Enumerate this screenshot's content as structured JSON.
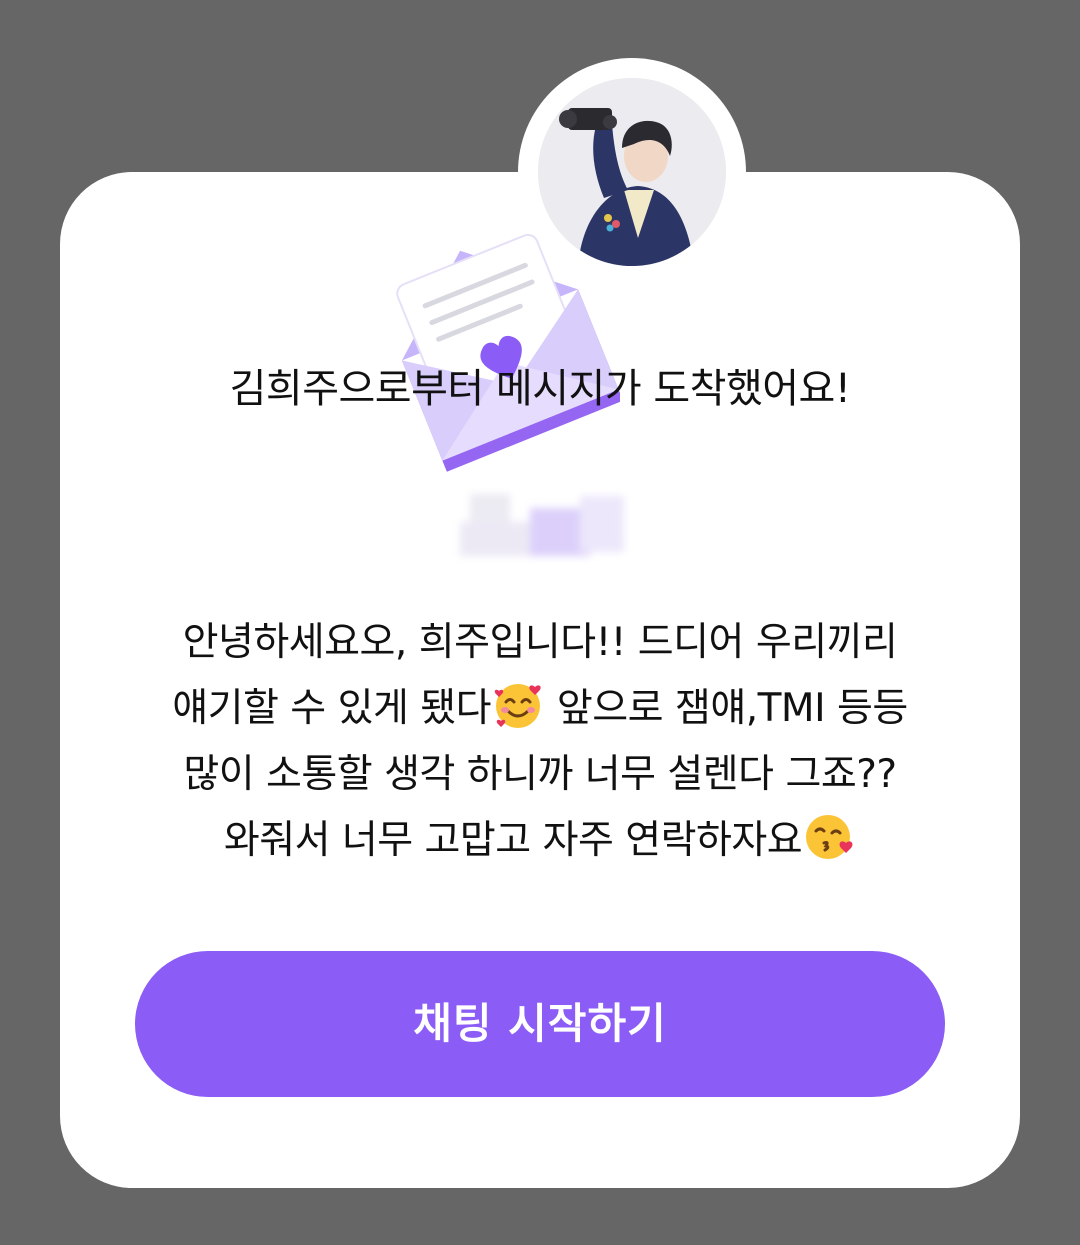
{
  "dialog": {
    "title": "김희주으로부터 메시지가 도착했어요!",
    "message": {
      "line1": "안녕하세요오, 희주입니다!! 드디어 우리끼리",
      "line2_a": "얘기할 수 있게 됐다",
      "line2_b": " 앞으로 잼얘,TMI 등등",
      "line3": "많이 소통할 생각 하니까 너무 설렌다 그죠??",
      "line4_a": "와줘서 너무 고맙고 자주 연락하자요"
    },
    "button_label": "채팅 시작하기"
  },
  "colors": {
    "overlay": "#666666",
    "accent": "#8b5cf6",
    "envelope_light": "#d9cdfc",
    "envelope_dark": "#9466f2"
  },
  "icons": {
    "envelope": "envelope-heart-icon",
    "emoji_1": "smiling-face-with-hearts",
    "emoji_2": "face-blowing-kiss"
  }
}
